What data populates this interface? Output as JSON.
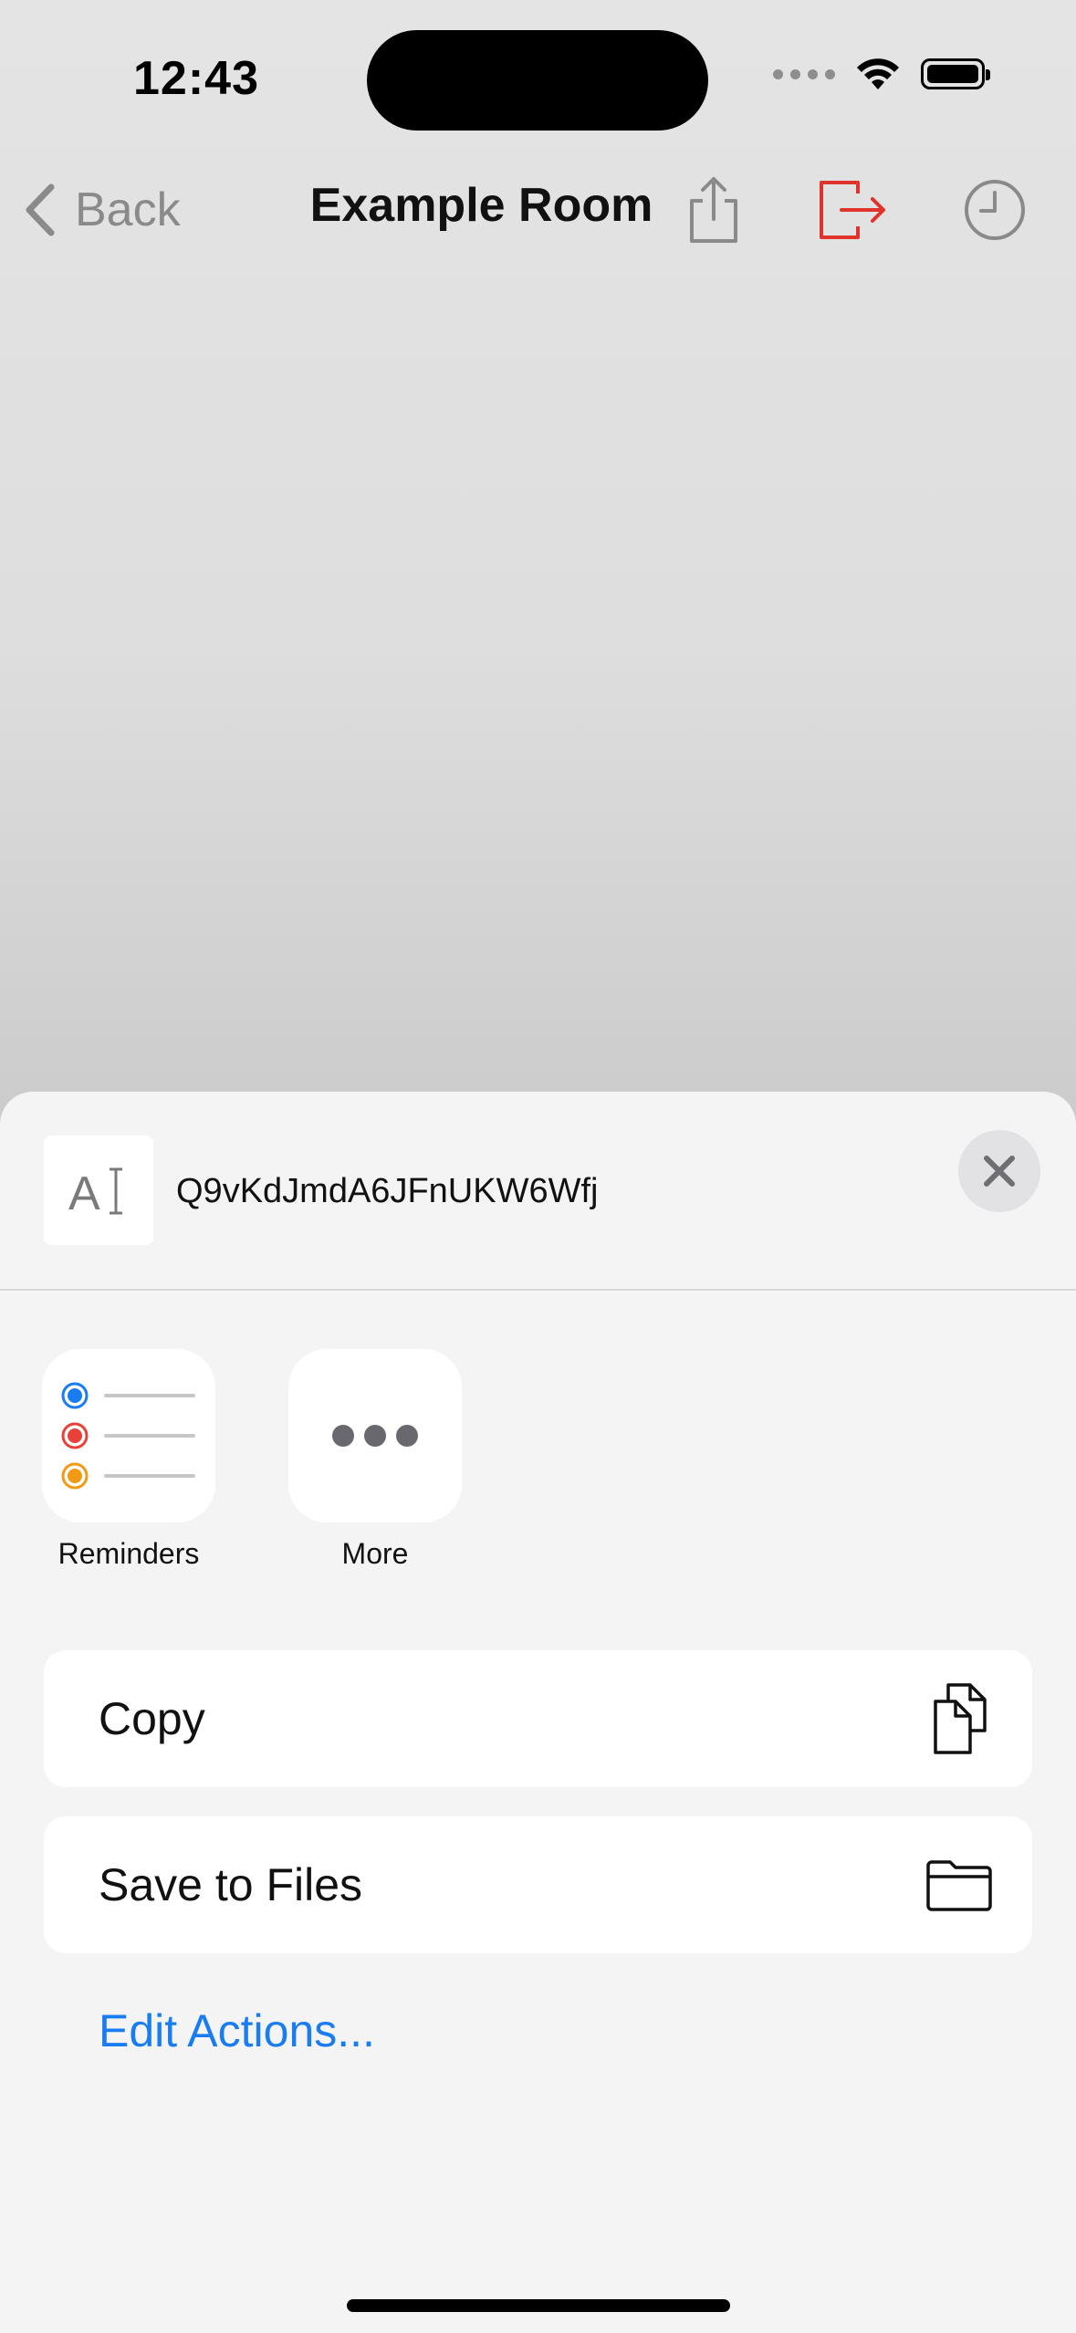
{
  "status_bar": {
    "time": "12:43"
  },
  "nav": {
    "back_label": "Back",
    "title": "Example Room",
    "icons": [
      "share-icon",
      "leave-icon",
      "history-icon"
    ],
    "leave_color": "#e0332b"
  },
  "share_sheet": {
    "preview": {
      "icon": "text-cursor-icon",
      "title": "Q9vKdJmdA6JFnUKW6Wfj"
    },
    "apps": [
      {
        "label": "Reminders",
        "icon": "reminders-icon"
      },
      {
        "label": "More",
        "icon": "more-icon"
      }
    ],
    "actions": [
      {
        "label": "Copy",
        "icon": "copy-icon"
      },
      {
        "label": "Save to Files",
        "icon": "folder-icon"
      }
    ],
    "edit_actions_label": "Edit Actions...",
    "link_color": "#1a7cf1"
  }
}
